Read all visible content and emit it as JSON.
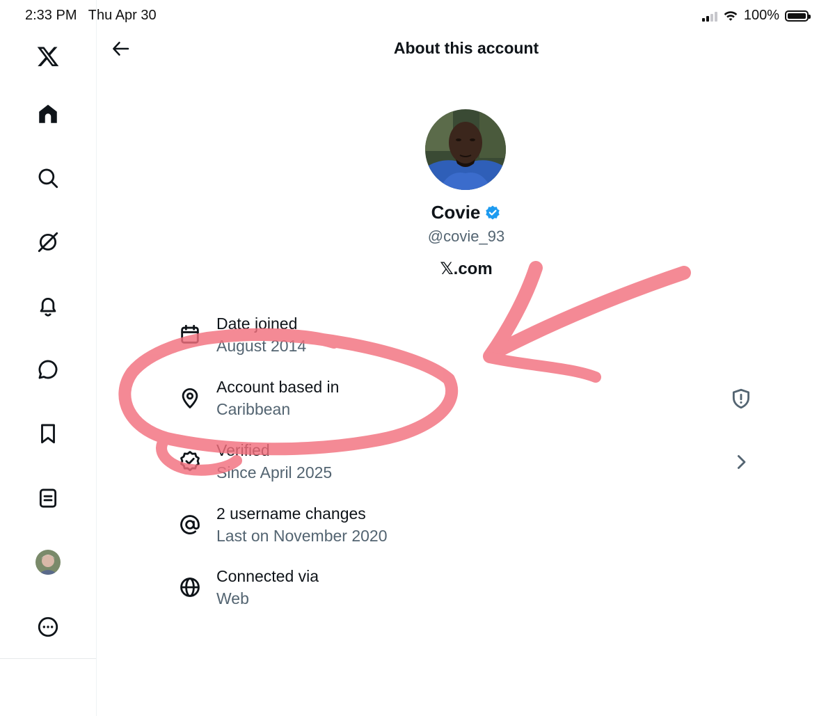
{
  "status_bar": {
    "time": "2:33 PM",
    "date": "Thu Apr 30",
    "battery": "100%"
  },
  "sidebar": {
    "items": [
      {
        "icon": "x-logo-icon"
      },
      {
        "icon": "home-icon"
      },
      {
        "icon": "search-icon"
      },
      {
        "icon": "grok-icon"
      },
      {
        "icon": "bell-icon"
      },
      {
        "icon": "messages-icon"
      },
      {
        "icon": "bookmark-icon"
      },
      {
        "icon": "lists-icon"
      },
      {
        "icon": "profile-avatar"
      },
      {
        "icon": "more-icon"
      }
    ]
  },
  "header": {
    "title": "About this account",
    "back_icon": "arrow-left-icon"
  },
  "profile": {
    "name": "Covie",
    "handle": "@covie_93",
    "site": "𝕏.com",
    "verified": true,
    "verified_color": "#1d9bf0"
  },
  "rows": [
    {
      "icon": "calendar-icon",
      "label": "Date joined",
      "value": "August 2014"
    },
    {
      "icon": "location-pin-icon",
      "label": "Account based in",
      "value": "Caribbean",
      "trailing": "shield-alert-icon"
    },
    {
      "icon": "verified-badge-icon",
      "label": "Verified",
      "value": "Since April 2025",
      "trailing": "chevron-right-icon"
    },
    {
      "icon": "at-sign-icon",
      "label": "2 username changes",
      "value": "Last on November 2020"
    },
    {
      "icon": "globe-icon",
      "label": "Connected via",
      "value": "Web"
    }
  ],
  "colors": {
    "text_primary": "#0f1419",
    "text_secondary": "#536471",
    "annotation": "#f2707e"
  }
}
